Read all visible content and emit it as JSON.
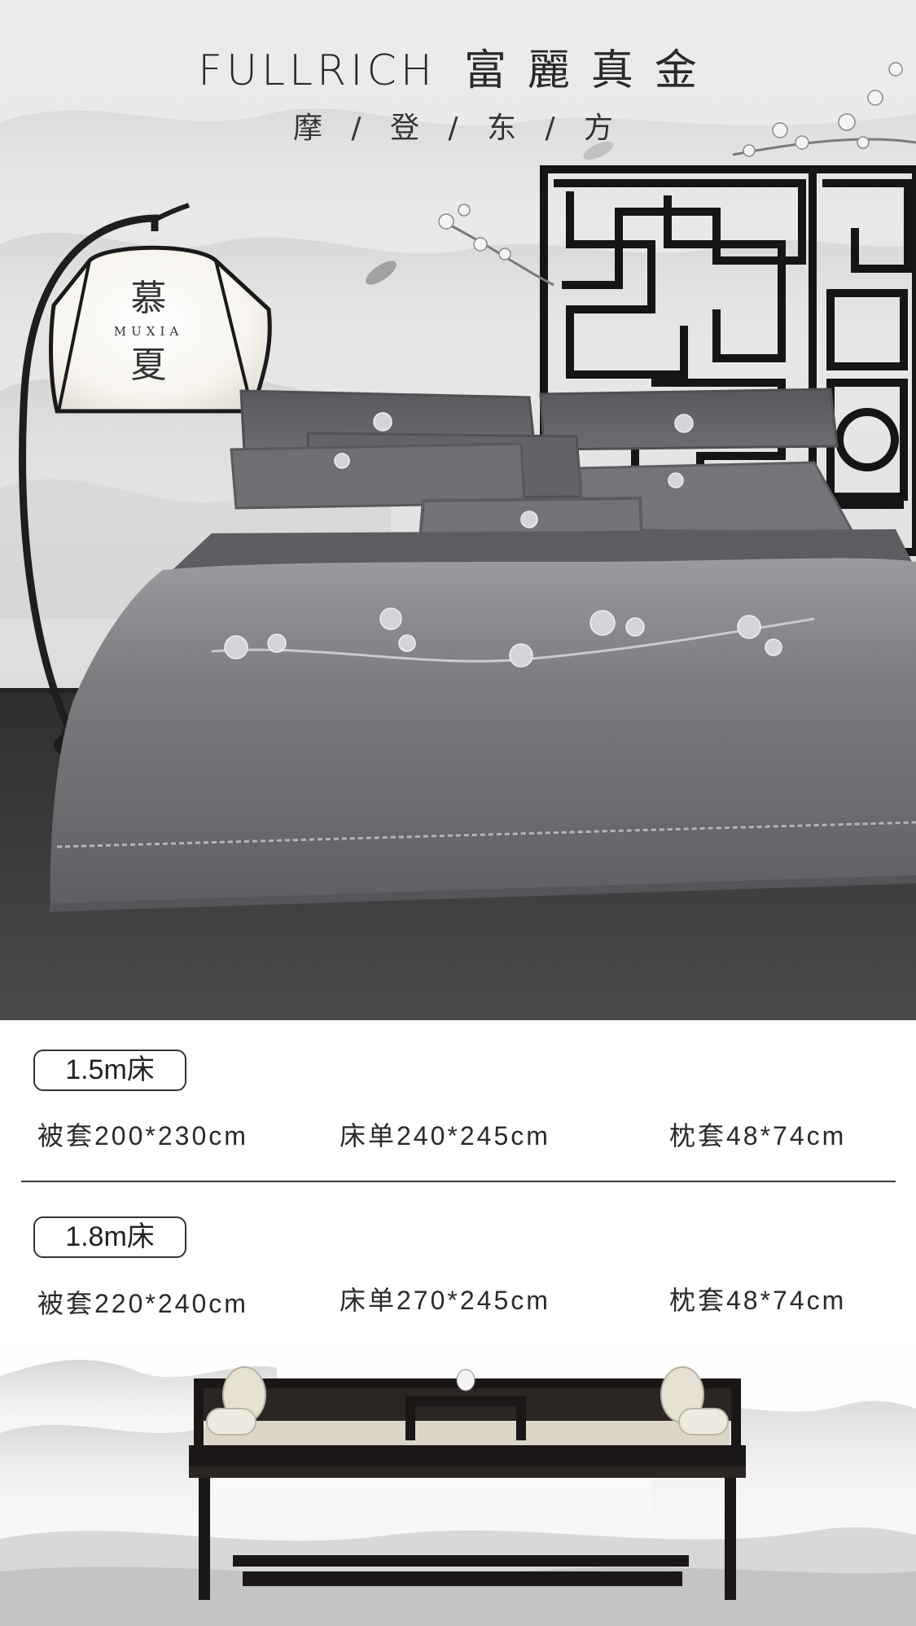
{
  "brand": {
    "en": "FULLRICH",
    "cn": "富麗真金",
    "tagline": "摩 / 登 / 东 / 方"
  },
  "lamp": {
    "char_top": "慕",
    "latin": "MUXIA",
    "char_bottom": "夏"
  },
  "specs": [
    {
      "size": "1.5m床",
      "items": [
        "被套200*230cm",
        "床单240*245cm",
        "枕套48*74cm"
      ]
    },
    {
      "size": "1.8m床",
      "items": [
        "被套220*240cm",
        "床单270*245cm",
        "枕套48*74cm"
      ]
    }
  ],
  "colors": {
    "bedding": "#6f7073",
    "floor": "#3d3d3e",
    "frame": "#1c1c1c",
    "mist": "#c9c9c9"
  }
}
